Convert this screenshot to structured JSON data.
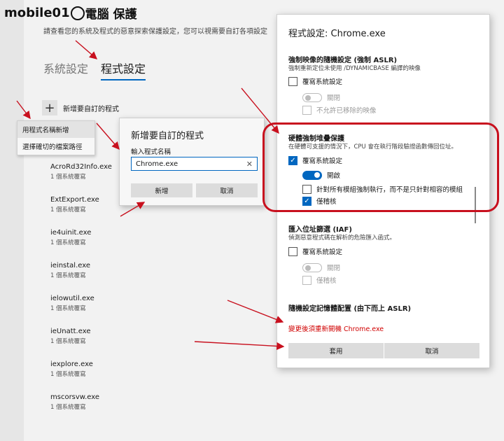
{
  "logo": {
    "text": "mobile01",
    "suffix": "電腦 保護"
  },
  "description": "請查看您的系統及程式的惡意探索保護設定，您可以視需要自訂各項設定",
  "tabs": [
    {
      "label": "系統設定",
      "active": false
    },
    {
      "label": "程式設定",
      "active": true
    }
  ],
  "add_program_label": "新增要自訂的程式",
  "dropdown": {
    "items": [
      "用程式名稱新增",
      "選擇確切的檔案路徑"
    ]
  },
  "programs": [
    {
      "name": "…exe",
      "sub": ""
    },
    {
      "name": "AcroRd32Info.exe",
      "sub": "1 個系統覆寫"
    },
    {
      "name": "ExtExport.exe",
      "sub": "1 個系統覆寫"
    },
    {
      "name": "ie4uinit.exe",
      "sub": "1 個系統覆寫"
    },
    {
      "name": "ieinstal.exe",
      "sub": "1 個系統覆寫"
    },
    {
      "name": "ielowutil.exe",
      "sub": "1 個系統覆寫"
    },
    {
      "name": "ieUnatt.exe",
      "sub": "1 個系統覆寫"
    },
    {
      "name": "iexplore.exe",
      "sub": "1 個系統覆寫"
    },
    {
      "name": "mscorsvw.exe",
      "sub": "1 個系統覆寫"
    }
  ],
  "add_dialog": {
    "title": "新增要自訂的程式",
    "input_label": "輸入程式名稱",
    "input_value": "Chrome.exe",
    "add_button": "新增",
    "cancel_button": "取消"
  },
  "panel": {
    "title": "程式設定: Chrome.exe",
    "sections": {
      "aslr": {
        "heading": "強制映像的隨機設定 (強制 ASLR)",
        "desc": "強制重新定位未使用 /DYNAMICBASE 編譯的映像",
        "override_label": "覆寫系統設定",
        "toggle_label": "關閉",
        "sub_label": "不允許已移除的映像"
      },
      "stack": {
        "heading": "硬體強制堆疊保護",
        "desc": "在硬體可支援的情況下，CPU 會在執行階段驗證函數傳回位址。",
        "override_label": "覆寫系統設定",
        "toggle_label": "開啟",
        "all_modules_label": "針對所有模組強制執行，而不是只針對相容的模組",
        "audit_label": "僅稽核"
      },
      "iaf": {
        "heading": "匯入位址篩選 (IAF)",
        "desc": "偵測惡意程式碼在解析的危險匯入函式。",
        "override_label": "覆寫系統設定",
        "toggle_label": "關閉",
        "audit_label": "僅稽核"
      },
      "bottomup": {
        "heading": "隨機設定記憶體配置 (由下而上 ASLR)"
      }
    },
    "warning": "變更後須重新開機 Chrome.exe",
    "apply_button": "套用",
    "cancel_button": "取消"
  },
  "colors": {
    "accent": "#0067c0",
    "highlight_frame": "#c8101e",
    "warning": "#d00000"
  }
}
